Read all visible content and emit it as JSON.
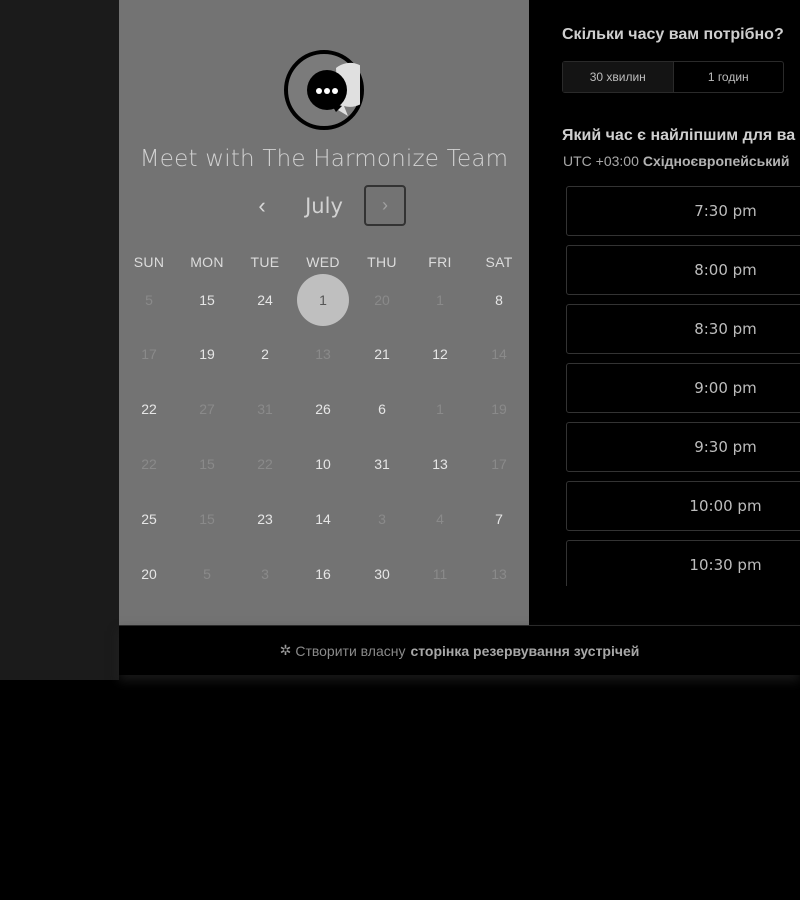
{
  "calendar": {
    "title": "Meet with The Harmonize Team",
    "month": "July",
    "prev_label": "‹",
    "next_label": "›",
    "weekdays": [
      "SUN",
      "MON",
      "TUE",
      "WED",
      "THU",
      "FRI",
      "SAT"
    ],
    "weeks": [
      [
        {
          "d": "5",
          "on": false
        },
        {
          "d": "15",
          "on": true
        },
        {
          "d": "24",
          "on": true
        },
        {
          "d": "1",
          "on": true,
          "selected": true
        },
        {
          "d": "20",
          "on": false
        },
        {
          "d": "1",
          "on": false
        },
        {
          "d": "8",
          "on": true
        }
      ],
      [
        {
          "d": "17",
          "on": false
        },
        {
          "d": "19",
          "on": true
        },
        {
          "d": "2",
          "on": true
        },
        {
          "d": "13",
          "on": false
        },
        {
          "d": "21",
          "on": true
        },
        {
          "d": "12",
          "on": true
        },
        {
          "d": "14",
          "on": false
        }
      ],
      [
        {
          "d": "22",
          "on": true
        },
        {
          "d": "27",
          "on": false
        },
        {
          "d": "31",
          "on": false
        },
        {
          "d": "26",
          "on": true
        },
        {
          "d": "6",
          "on": true
        },
        {
          "d": "1",
          "on": false
        },
        {
          "d": "19",
          "on": false
        }
      ],
      [
        {
          "d": "22",
          "on": false
        },
        {
          "d": "15",
          "on": false
        },
        {
          "d": "22",
          "on": false
        },
        {
          "d": "10",
          "on": true
        },
        {
          "d": "31",
          "on": true
        },
        {
          "d": "13",
          "on": true
        },
        {
          "d": "17",
          "on": false
        }
      ],
      [
        {
          "d": "25",
          "on": true
        },
        {
          "d": "15",
          "on": false
        },
        {
          "d": "23",
          "on": true
        },
        {
          "d": "14",
          "on": true
        },
        {
          "d": "3",
          "on": false
        },
        {
          "d": "4",
          "on": false
        },
        {
          "d": "7",
          "on": true
        }
      ],
      [
        {
          "d": "20",
          "on": true
        },
        {
          "d": "5",
          "on": false
        },
        {
          "d": "3",
          "on": false
        },
        {
          "d": "16",
          "on": true
        },
        {
          "d": "30",
          "on": true
        },
        {
          "d": "11",
          "on": false
        },
        {
          "d": "13",
          "on": false
        }
      ]
    ]
  },
  "duration": {
    "question": "Скільки часу вам потрібно?",
    "options": [
      "30 хвилин",
      "1 годин"
    ],
    "selected_index": 0
  },
  "time": {
    "question": "Який час є найліпшим для ва",
    "timezone_offset": "UTC +03:00",
    "timezone_name": "Східноєвропейський",
    "slots": [
      "7:30 pm",
      "8:00 pm",
      "8:30 pm",
      "9:00 pm",
      "9:30 pm",
      "10:00 pm",
      "10:30 pm"
    ]
  },
  "footer": {
    "prefix": "Створити власну",
    "bold": "сторінка резервування зустрічей"
  },
  "icons": {
    "avatar": "chat-bubble-icon",
    "footer": "sprocket-icon"
  }
}
